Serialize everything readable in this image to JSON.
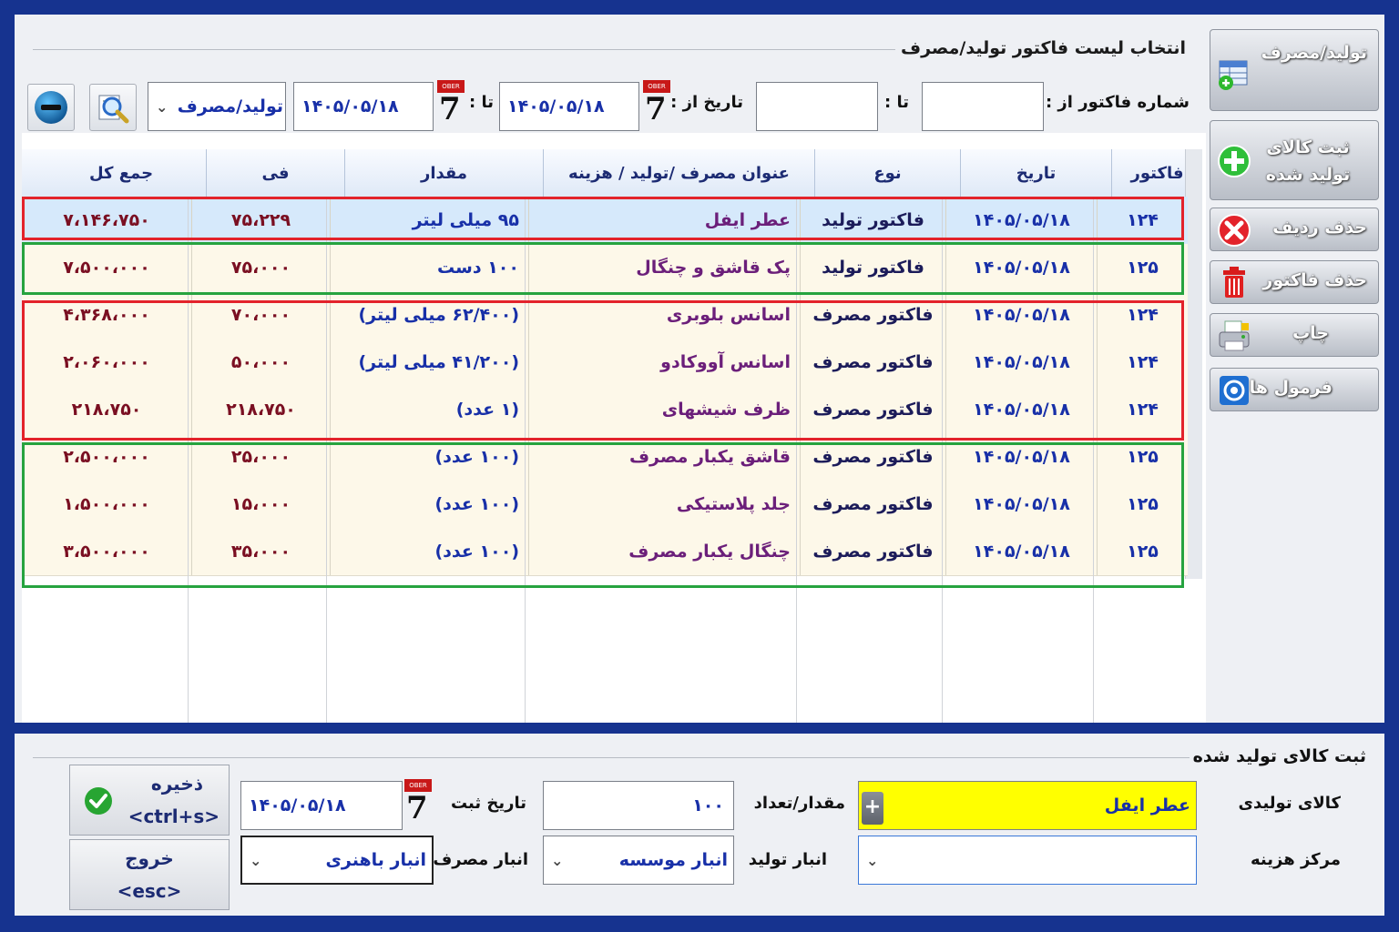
{
  "top_panel": {
    "title": "انتخاب لیست فاکتور تولید/مصرف",
    "filters": {
      "invoice_from_label": "شماره فاکتور از :",
      "invoice_from_value": "",
      "invoice_to_label": "تا :",
      "invoice_to_value": "",
      "date_from_label": "تاریخ از :",
      "date_from_value": "۱۴۰۵/۰۵/۱۸",
      "date_to_label": "تا :",
      "date_to_value": "۱۴۰۵/۰۵/۱۸",
      "type_select_value": "تولید/مصرف",
      "calendar_top": "OBER",
      "calendar_day": "7"
    }
  },
  "table": {
    "columns": {
      "invoice": "فاکتور",
      "date": "تاریخ",
      "type": "نوع",
      "title": "عنوان مصرف /تولید / هزینه",
      "quantity": "مقدار",
      "fee": "فی",
      "total": "جمع کل"
    },
    "rows": [
      {
        "invoice": "۱۲۴",
        "date": "۱۴۰۵/۰۵/۱۸",
        "type": "فاکتور تولید",
        "title": "عطر ایفل",
        "quantity": "۹۵ میلی لیتر",
        "fee": "۷۵،۲۲۹",
        "total": "۷،۱۴۶،۷۵۰"
      },
      {
        "invoice": "۱۲۵",
        "date": "۱۴۰۵/۰۵/۱۸",
        "type": "فاکتور تولید",
        "title": "پک قاشق و چنگال",
        "quantity": "۱۰۰ دست",
        "fee": "۷۵،۰۰۰",
        "total": "۷،۵۰۰،۰۰۰"
      },
      {
        "invoice": "۱۲۴",
        "date": "۱۴۰۵/۰۵/۱۸",
        "type": "فاکتور مصرف",
        "title": "اسانس بلوبری",
        "quantity": "(۶۲/۴۰۰ میلی لیتر)",
        "fee": "۷۰،۰۰۰",
        "total": "۴،۳۶۸،۰۰۰"
      },
      {
        "invoice": "۱۲۴",
        "date": "۱۴۰۵/۰۵/۱۸",
        "type": "فاکتور مصرف",
        "title": "اسانس آووکادو",
        "quantity": "(۴۱/۲۰۰ میلی لیتر)",
        "fee": "۵۰،۰۰۰",
        "total": "۲،۰۶۰،۰۰۰"
      },
      {
        "invoice": "۱۲۴",
        "date": "۱۴۰۵/۰۵/۱۸",
        "type": "فاکتور مصرف",
        "title": "ظرف شیشهای",
        "quantity": "(۱ عدد)",
        "fee": "۲۱۸،۷۵۰",
        "total": "۲۱۸،۷۵۰"
      },
      {
        "invoice": "۱۲۵",
        "date": "۱۴۰۵/۰۵/۱۸",
        "type": "فاکتور مصرف",
        "title": "قاشق یکبار مصرف",
        "quantity": "(۱۰۰ عدد)",
        "fee": "۲۵،۰۰۰",
        "total": "۲،۵۰۰،۰۰۰"
      },
      {
        "invoice": "۱۲۵",
        "date": "۱۴۰۵/۰۵/۱۸",
        "type": "فاکتور مصرف",
        "title": "جلد پلاستیکی",
        "quantity": "(۱۰۰ عدد)",
        "fee": "۱۵،۰۰۰",
        "total": "۱،۵۰۰،۰۰۰"
      },
      {
        "invoice": "۱۲۵",
        "date": "۱۴۰۵/۰۵/۱۸",
        "type": "فاکتور مصرف",
        "title": "چنگال یکبار مصرف",
        "quantity": "(۱۰۰ عدد)",
        "fee": "۳۵،۰۰۰",
        "total": "۳،۵۰۰،۰۰۰"
      }
    ]
  },
  "side_buttons": [
    {
      "label": "تولید/مصرف",
      "icon": "table-add-icon"
    },
    {
      "label": "ثبت کالای تولید شده",
      "icon": "plus-circle-icon"
    },
    {
      "label": "حذف ردیف",
      "icon": "x-circle-icon"
    },
    {
      "label": "حذف فاکتور",
      "icon": "trash-icon"
    },
    {
      "label": "چاپ",
      "icon": "printer-icon"
    },
    {
      "label": "فرمول ها",
      "icon": "formula-icon"
    }
  ],
  "bottom_panel": {
    "title": "ثبت کالای تولید شده",
    "product_label": "کالای تولیدی",
    "product_value": "عطر ایفل",
    "qty_label": "مقدار/تعداد",
    "qty_value": "۱۰۰",
    "reg_date_label": "تاریخ ثبت",
    "reg_date_value": "۱۴۰۵/۰۵/۱۸",
    "cost_center_label": "مرکز هزینه",
    "cost_center_value": "",
    "production_store_label": "انبار تولید",
    "production_store_value": "انبار موسسه",
    "consumption_store_label": "انبار مصرف",
    "consumption_store_value": "انبار باهنری",
    "save_label": "ذخیره",
    "save_shortcut": "<ctrl+s>",
    "exit_label": "خروج",
    "exit_shortcut": "<esc>"
  },
  "colors": {
    "frame_blue": "#16338f",
    "highlight_red": "#e3232b",
    "highlight_green": "#26a33f",
    "product_field_yellow": "#ffff00"
  }
}
